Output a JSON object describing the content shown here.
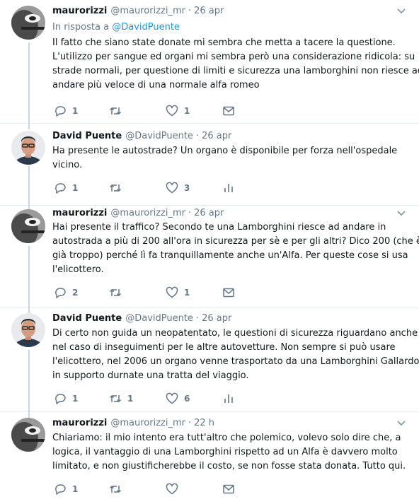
{
  "icons": {
    "reply": "reply-icon",
    "retweet": "retweet-icon",
    "like": "heart-icon",
    "dm": "envelope-icon",
    "analytics": "analytics-icon",
    "more": "chevron-down-icon"
  },
  "colors": {
    "text": "#14171a",
    "secondary": "#657786",
    "link": "#1b95e0",
    "thread_line": "#ccd6dd",
    "divider": "#e6ecf0"
  },
  "tweets": [
    {
      "name": "maurorizzi",
      "handle": "@maurorizzi_mr",
      "dot": "·",
      "time": "26 apr",
      "reply_prefix": "In risposta a",
      "reply_mention": "@DavidPuente",
      "lines": [
        "Il fatto che siano state donate mi sembra che metta a tacere la questione.",
        "L'utilizzo per sangue ed organi mi sembra però una considerazione ridicola: su",
        "strade normali, per questione di limiti e sicurezza una lamborghini non riesce ad",
        "andare più veloce di una normale alfa romeo"
      ],
      "replies": "1",
      "retweets": "",
      "likes": "1"
    },
    {
      "name": "David Puente",
      "handle": "@DavidPuente",
      "dot": "·",
      "time": "26 apr",
      "lines": [
        "Ha presente le autostrade? Un organo è disponibile per forza nell'ospedale",
        "vicino."
      ],
      "replies": "1",
      "retweets": "",
      "likes": "3"
    },
    {
      "name": "maurorizzi",
      "handle": "@maurorizzi_mr",
      "dot": "·",
      "time": "26 apr",
      "lines": [
        "Hai presente il traffico? Secondo te una Lamborghini riesce ad andare in",
        "autostrada a più di 200 all'ora in sicurezza per sè e per gli altri? Dico 200 (che è",
        "già troppo) perché lì fa tranquillamente anche un'Alfa. Per queste cose si usa",
        "l'elicottero."
      ],
      "replies": "2",
      "retweets": "",
      "likes": "1"
    },
    {
      "name": "David Puente",
      "handle": "@DavidPuente",
      "dot": "·",
      "time": "26 apr",
      "lines": [
        "Di certo non guida un neopatentato, le questioni di sicurezza riguardano anche",
        "nel caso di inseguimenti per le altre autovetture. Non sempre si può usare",
        "l'elicottero, nel 2006 un organo venne trasportato da una Lamborghini Gallardo",
        "in supporto durnate una tratta del viaggio."
      ],
      "replies": "1",
      "retweets": "1",
      "likes": "6"
    },
    {
      "name": "maurorizzi",
      "handle": "@maurorizzi_mr",
      "dot": "·",
      "time": "22 h",
      "lines": [
        "Chiariamo: il mio intento era tutt'altro che polemico, volevo solo dire che, a",
        "logica, il vantaggio di una Lamborghini rispetto ad un Alfa è davvero molto",
        "limitato, e non giustificherebbe il costo, se non fosse stata donata. Tutto qui."
      ],
      "replies": "1",
      "retweets": "",
      "likes": ""
    }
  ]
}
